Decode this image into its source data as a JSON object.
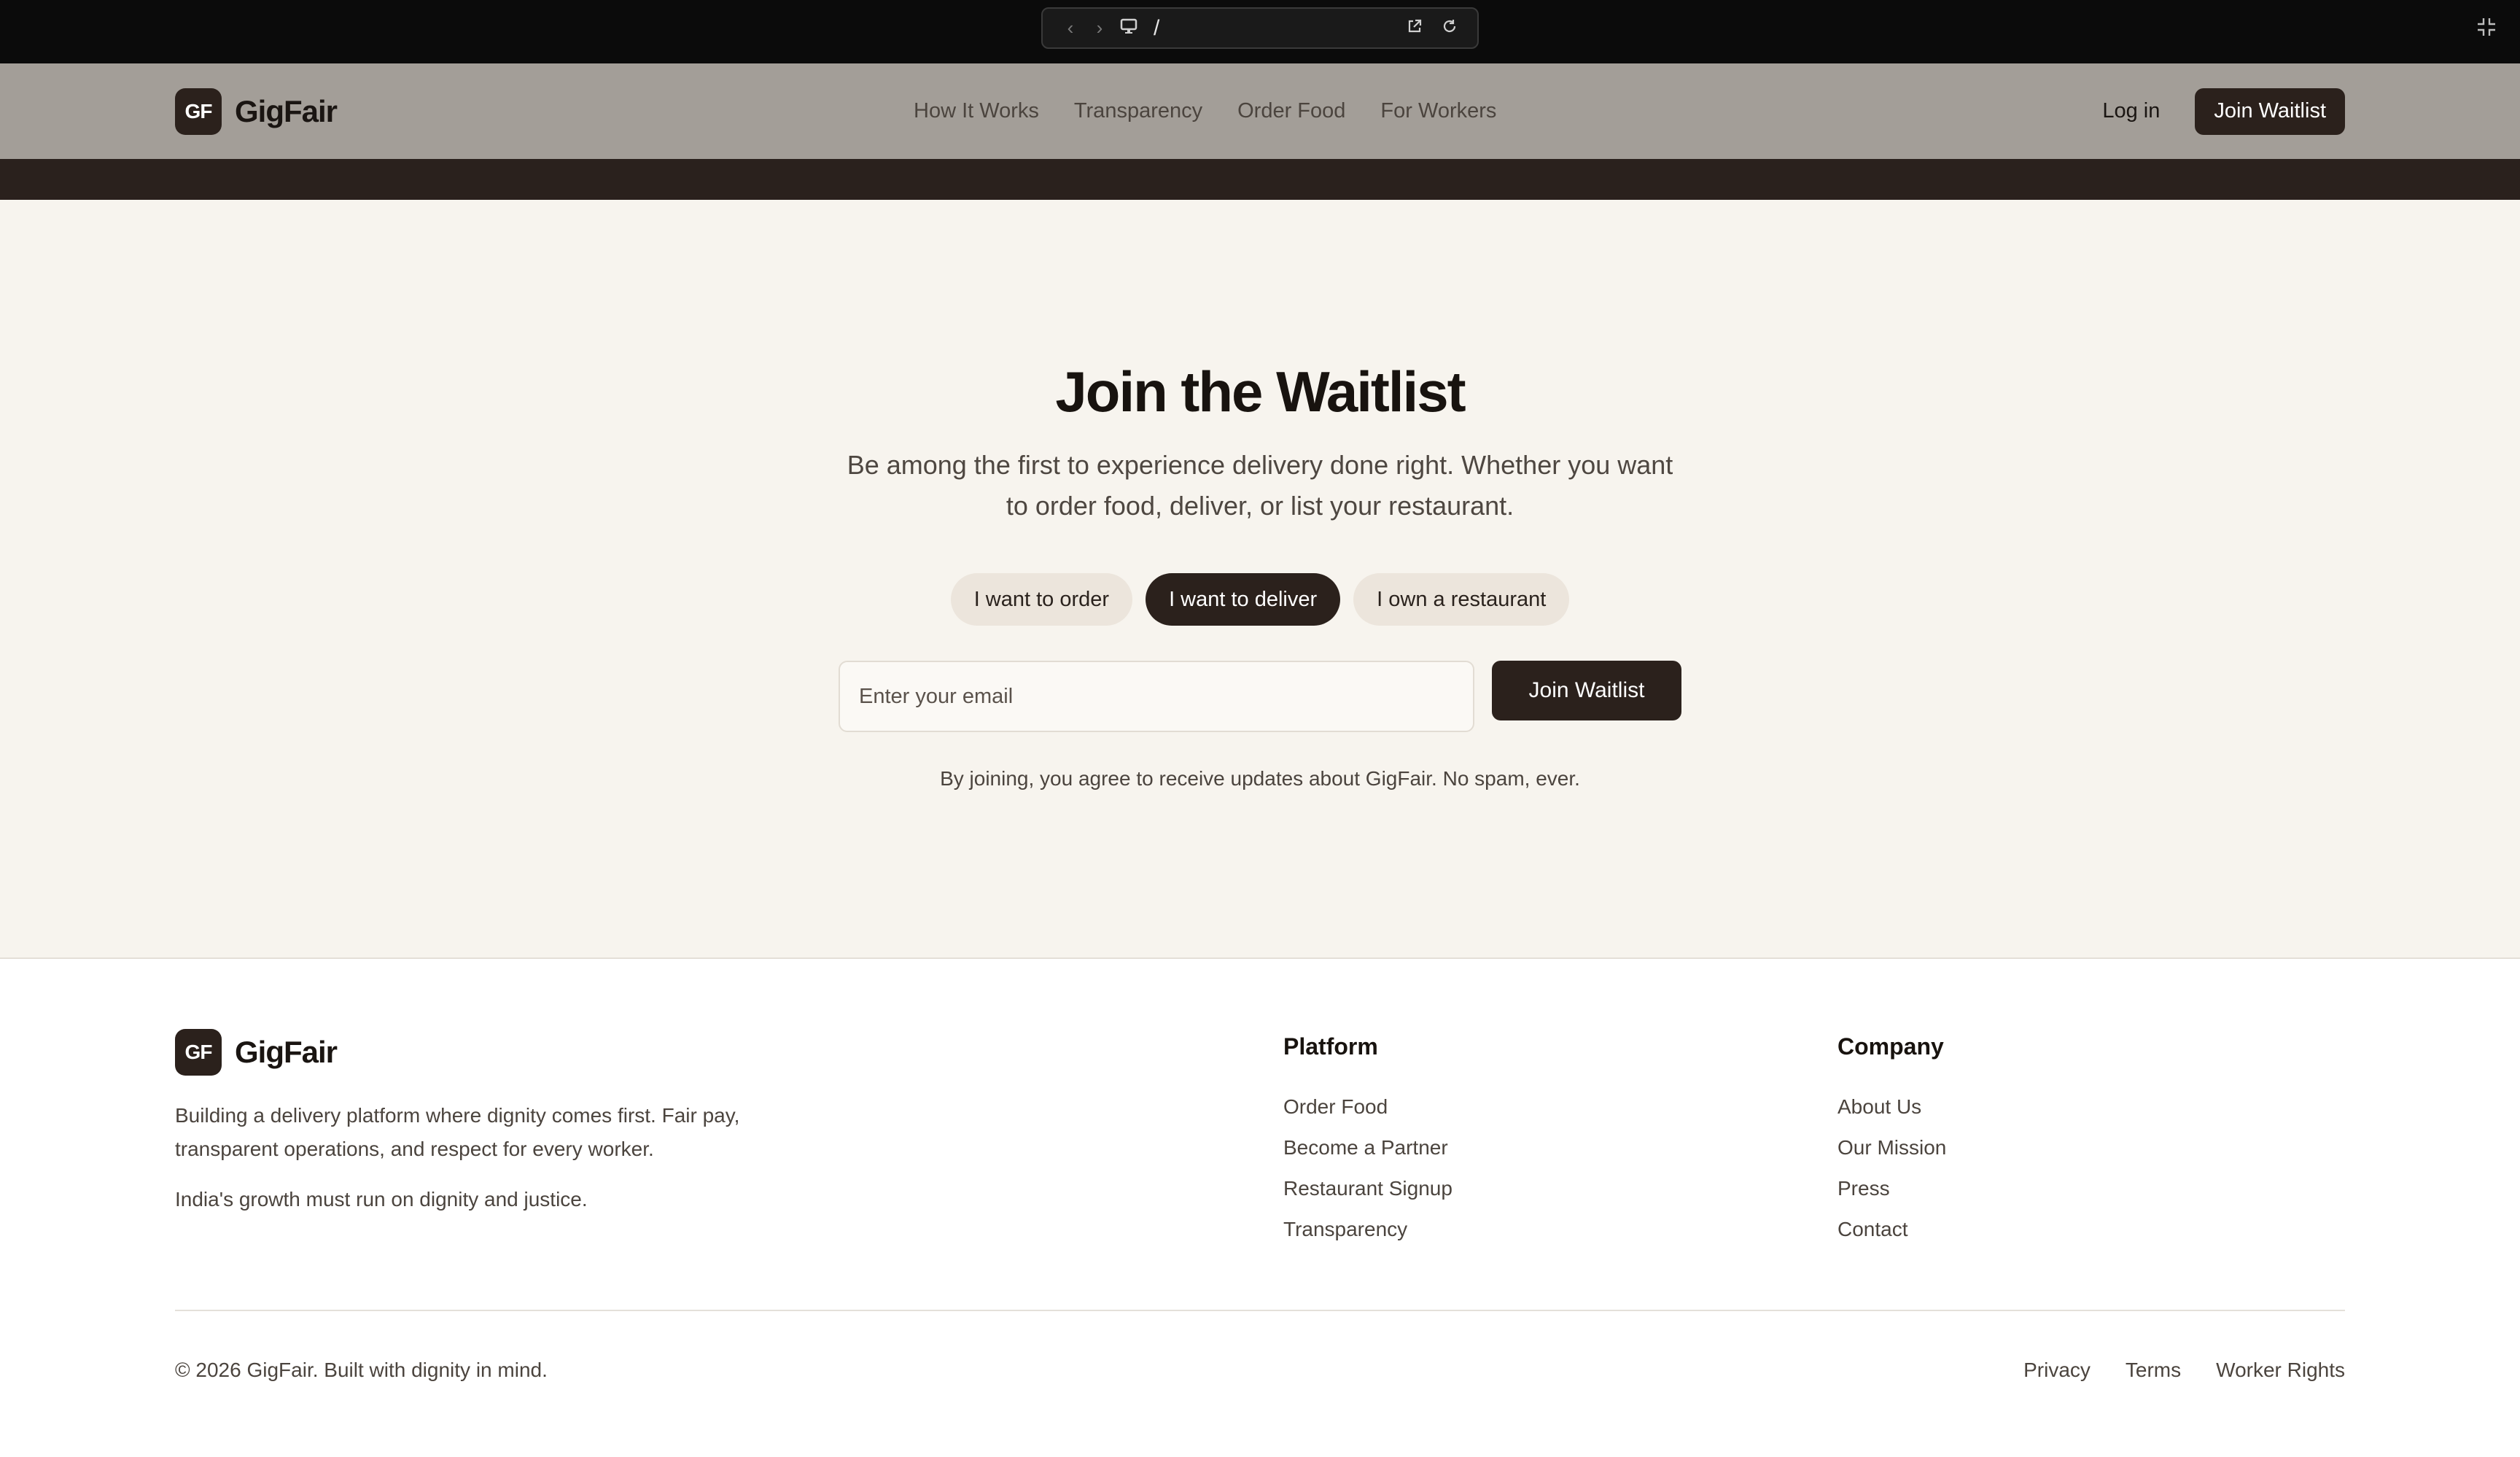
{
  "browser": {
    "url_path": "/",
    "icons": [
      "chevron-left-icon",
      "chevron-right-icon",
      "monitor-icon",
      "external-link-icon",
      "reload-icon",
      "collapse-icon"
    ]
  },
  "header": {
    "logo_mark": "GF",
    "brand_name": "GigFair",
    "nav": [
      "How It Works",
      "Transparency",
      "Order Food",
      "For Workers"
    ],
    "login_label": "Log in",
    "cta_label": "Join Waitlist"
  },
  "waitlist": {
    "title": "Join the Waitlist",
    "subtitle": "Be among the first to experience delivery done right. Whether you want to order food, deliver, or list your restaurant.",
    "roles": [
      {
        "label": "I want to order",
        "selected": false
      },
      {
        "label": "I want to deliver",
        "selected": true
      },
      {
        "label": "I own a restaurant",
        "selected": false
      }
    ],
    "email_placeholder": "Enter your email",
    "email_value": "",
    "submit_label": "Join Waitlist",
    "disclaimer": "By joining, you agree to receive updates about GigFair. No spam, ever."
  },
  "footer": {
    "logo_mark": "GF",
    "brand_name": "GigFair",
    "description": "Building a delivery platform where dignity comes first. Fair pay, transparent operations, and respect for every worker.",
    "motto": "India's growth must run on dignity and justice.",
    "platform": {
      "heading": "Platform",
      "links": [
        "Order Food",
        "Become a Partner",
        "Restaurant Signup",
        "Transparency"
      ]
    },
    "company": {
      "heading": "Company",
      "links": [
        "About Us",
        "Our Mission",
        "Press",
        "Contact"
      ]
    },
    "copyright": "© 2026 GigFair. Built with dignity in mind.",
    "legal_links": [
      "Privacy",
      "Terms",
      "Worker Rights"
    ]
  },
  "colors": {
    "header_bg": "#a39e98",
    "accent_dark": "#2b211c",
    "section_bg": "#f7f4ee",
    "chip_bg": "#ece5dc"
  }
}
